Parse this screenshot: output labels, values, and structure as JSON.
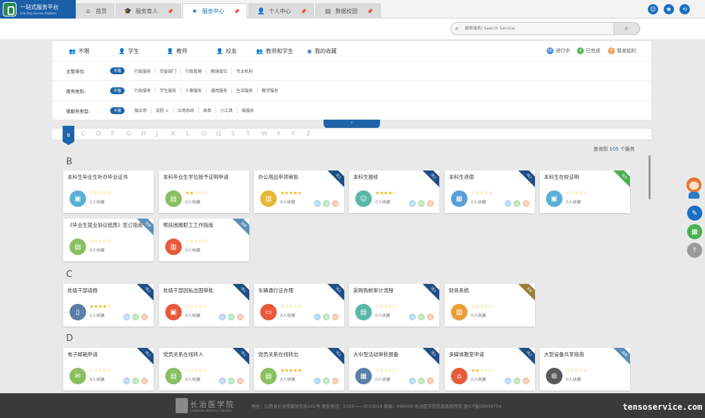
{
  "app": {
    "title": "一站式服务平台",
    "subtitle": "One-Stop Service Platform"
  },
  "tabs": [
    {
      "label": "首页",
      "icon": "home-icon",
      "active": false,
      "pinned": false
    },
    {
      "label": "服务育人",
      "icon": "graduation-cap-icon",
      "active": false,
      "pinned": true
    },
    {
      "label": "服务中心",
      "icon": "star-icon",
      "active": true,
      "pinned": true
    },
    {
      "label": "个人中心",
      "icon": "user-icon",
      "active": false,
      "pinned": true
    },
    {
      "label": "数据校园",
      "icon": "grid-icon",
      "active": false,
      "pinned": true
    }
  ],
  "search": {
    "placeholder": "搜索服务/ Search Service"
  },
  "filter_tabs": [
    {
      "label": "不限",
      "icon": "users-icon",
      "active": true
    },
    {
      "label": "学生",
      "icon": "student-icon",
      "active": false
    },
    {
      "label": "教师",
      "icon": "teacher-icon",
      "active": false
    },
    {
      "label": "校友",
      "icon": "alumni-icon",
      "active": false
    },
    {
      "label": "教师和学生",
      "icon": "group-icon",
      "active": false
    },
    {
      "label": "我的收藏",
      "icon": "favorite-icon",
      "active": false
    }
  ],
  "status": [
    {
      "count": "55",
      "label": "进行中",
      "color": "#4a90d9"
    },
    {
      "count": "4",
      "label": "已完成",
      "color": "#5cb85c"
    },
    {
      "count": "0",
      "label": "我发起的",
      "color": "#f0a060"
    }
  ],
  "filter_rows": [
    {
      "label": "主管单位:",
      "selected": "不限",
      "options": [
        "行政服务",
        "党委部门",
        "行政管理",
        "教辅单位",
        "专业机构"
      ]
    },
    {
      "label": "服务类别:",
      "selected": "不限",
      "options": [
        "行政服务",
        "学生服务",
        "人事服务",
        "通用服务",
        "生活服务",
        "教学服务"
      ]
    },
    {
      "label": "微服务类型:",
      "selected": "不限",
      "options": [
        "微应用",
        "流程 >",
        "应用系统",
        "表单",
        "小工具",
        "微服务"
      ]
    }
  ],
  "collapse_label": "˄",
  "alphabet": [
    "B",
    "C",
    "D",
    "F",
    "G",
    "H",
    "J",
    "K",
    "L",
    "O",
    "Q",
    "S",
    "T",
    "W",
    "X",
    "Y",
    "Z"
  ],
  "active_letter": "B",
  "result": {
    "prefix": "查询到",
    "count": "105",
    "suffix": "个服务"
  },
  "sections": [
    {
      "letter": "B",
      "cards": [
        {
          "title": "本科生毕业生补办毕业证书",
          "stars": "☆☆☆☆☆",
          "rating": 0,
          "fav": "1人收藏",
          "ribbon": "",
          "icon": "certificate-icon",
          "icon_color": "#5bb0d8",
          "badges": false
        },
        {
          "title": "本科毕业生学位授予证明申请",
          "stars": "★★☆☆☆",
          "rating": 2.5,
          "fav": "0人收藏",
          "ribbon": "",
          "icon": "document-user-icon",
          "icon_color": "#8ac060",
          "badges": false
        },
        {
          "title": "办公用品申领审批",
          "stars": "★★★★★",
          "rating": 5,
          "fav": "0人收藏",
          "ribbon": "线上",
          "ribbon_color": "blue",
          "icon": "folder-icon",
          "icon_color": "#e8b838",
          "badges": true
        },
        {
          "title": "本科生报修",
          "stars": "★★★★☆",
          "rating": 4,
          "fav": "0人收藏",
          "ribbon": "线上",
          "ribbon_color": "blue",
          "icon": "repair-man-icon",
          "icon_color": "#59b8a8",
          "badges": true
        },
        {
          "title": "本科生退宿",
          "stars": "☆☆☆☆☆",
          "rating": 0,
          "fav": "0人收藏",
          "ribbon": "线上",
          "ribbon_color": "blue",
          "icon": "dorm-icon",
          "icon_color": "#5a9fd8",
          "badges": true
        },
        {
          "title": "本科生在校证明",
          "stars": "☆☆☆☆☆",
          "rating": 0,
          "fav": "0人收藏",
          "ribbon": "混合",
          "ribbon_color": "green",
          "icon": "id-card-icon",
          "icon_color": "#5bb0d8",
          "badges": false
        },
        {
          "title": "《毕业生就业协议纸质》签订指南",
          "stars": "☆☆☆☆☆",
          "rating": 0,
          "fav": "0人收藏",
          "ribbon": "指南",
          "ribbon_color": "gray",
          "icon": "agreement-icon",
          "icon_color": "#8ac060",
          "badges": false
        },
        {
          "title": "帮扶困难职工工作指南",
          "stars": "☆☆☆☆☆",
          "rating": 0,
          "fav": "0人收藏",
          "ribbon": "指南",
          "ribbon_color": "gray",
          "icon": "gift-icon",
          "icon_color": "#e85a3a",
          "badges": false
        }
      ]
    },
    {
      "letter": "C",
      "cards": [
        {
          "title": "处级干部请假",
          "stars": "★★★★☆",
          "rating": 4,
          "fav": "1人收藏",
          "ribbon": "线上",
          "ribbon_color": "blue",
          "icon": "phone-icon",
          "icon_color": "#5a7fa8",
          "badges": true
        },
        {
          "title": "处级干部因私出国审批",
          "stars": "☆☆☆☆☆",
          "rating": 0,
          "fav": "0人收藏",
          "ribbon": "线上",
          "ribbon_color": "blue",
          "icon": "passport-icon",
          "icon_color": "#e85a3a",
          "badges": true
        },
        {
          "title": "车辆通行证办理",
          "stars": "☆☆☆☆☆",
          "rating": 0,
          "fav": "0人收藏",
          "ribbon": "线上",
          "ribbon_color": "blue",
          "icon": "car-pass-icon",
          "icon_color": "#e85a3a",
          "badges": true
        },
        {
          "title": "采购购前审计流程",
          "stars": "☆☆☆☆☆",
          "rating": 0,
          "fav": "0人收藏",
          "ribbon": "线上",
          "ribbon_color": "blue",
          "icon": "printer-icon",
          "icon_color": "#59b8a8",
          "badges": true
        },
        {
          "title": "财务系统",
          "stars": "☆☆☆☆☆",
          "rating": 0,
          "fav": "0人收藏",
          "ribbon": "系统",
          "ribbon_color": "gold",
          "icon": "finance-icon",
          "icon_color": "#e8a038",
          "badges": false
        }
      ]
    },
    {
      "letter": "D",
      "cards": [
        {
          "title": "电子邮箱申请",
          "stars": "☆☆☆☆☆",
          "rating": 0,
          "fav": "4人收藏",
          "ribbon": "线上",
          "ribbon_color": "blue",
          "icon": "email-icon",
          "icon_color": "#8ac060",
          "badges": true
        },
        {
          "title": "党员关系在线转入",
          "stars": "☆☆☆☆☆",
          "rating": 0,
          "fav": "0人收藏",
          "ribbon": "线上",
          "ribbon_color": "blue",
          "icon": "transfer-in-icon",
          "icon_color": "#8ac060",
          "badges": true
        },
        {
          "title": "党员关系在线转出",
          "stars": "★★★★★",
          "rating": 5,
          "fav": "0人收藏",
          "ribbon": "线上",
          "ribbon_color": "blue",
          "icon": "transfer-out-icon",
          "icon_color": "#8ac060",
          "badges": true
        },
        {
          "title": "大中型活动审批报备",
          "stars": "☆☆☆☆☆",
          "rating": 0,
          "fav": "0人收藏",
          "ribbon": "线上",
          "ribbon_color": "blue",
          "icon": "building-icon",
          "icon_color": "#5a7fa8",
          "badges": true
        },
        {
          "title": "多媒体教室申请",
          "stars": "★★☆☆☆",
          "rating": 2.5,
          "fav": "0人收藏",
          "ribbon": "线上",
          "ribbon_color": "blue",
          "icon": "classroom-icon",
          "icon_color": "#e85a3a",
          "badges": true
        },
        {
          "title": "大型设备共享指南",
          "stars": "☆☆☆☆☆",
          "rating": 0,
          "fav": "0人收藏",
          "ribbon": "指南",
          "ribbon_color": "gray",
          "icon": "network-icon",
          "icon_color": "#5a5a5a",
          "badges": false
        }
      ]
    }
  ],
  "badge_labels": [
    "01",
    "02",
    "03"
  ],
  "footer": {
    "school": "长治医学院",
    "school_en": "CHANGZHI MEDICAL COLLEGE",
    "address": "地址：山西省长治市解放东街161号   联系电话：0355——3033016   邮编：046000   长治医学院信息版权所有   晋ICP备09009754"
  },
  "watermark": "tensoservice.com"
}
